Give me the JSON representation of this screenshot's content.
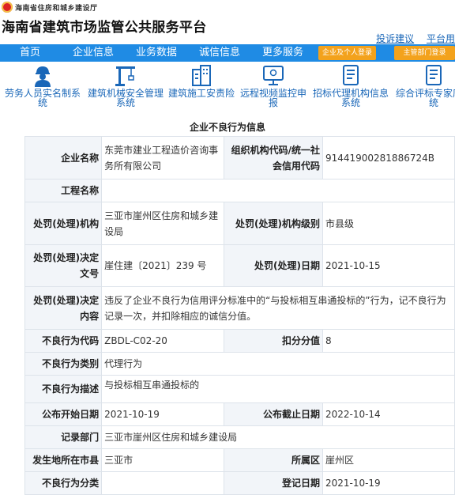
{
  "header": {
    "dept_name": "海南省住房和城乡建设厅",
    "site_title": "海南省建筑市场监管公共服务平台",
    "links": [
      "投诉建议",
      "平台用"
    ]
  },
  "nav": {
    "items": [
      "首页",
      "企业信息",
      "业务数据",
      "诚信信息",
      "更多服务"
    ],
    "buttons": [
      "企业及个人登录",
      "主管部门登录"
    ],
    "bar_color": "#1f8be4",
    "button_color": "#f3a21c"
  },
  "services": [
    {
      "label": "劳务人员实名制系统",
      "icon": "worker-icon"
    },
    {
      "label": "建筑机械安全管理系统",
      "icon": "crane-icon"
    },
    {
      "label": "建筑施工安责险",
      "icon": "buildings-icon"
    },
    {
      "label": "远程视频监控申报",
      "icon": "monitor-icon"
    },
    {
      "label": "招标代理机构信息系统",
      "icon": "document-icon"
    },
    {
      "label": "综合评标专家库系统",
      "icon": "document-icon"
    }
  ],
  "record": {
    "title": "企业不良行为信息",
    "rows": [
      {
        "k1": "企业名称",
        "v1": "东莞市建业工程造价咨询事务所有限公司",
        "k2": "组织机构代码/统一社会信用代码",
        "v2": "91441900281886724B"
      },
      {
        "k1": "工程名称",
        "v1": ""
      },
      {
        "k1": "处罚(处理)机构",
        "v1": "三亚市崖州区住房和城乡建设局",
        "k2": "处罚(处理)机构级别",
        "v2": "市县级"
      },
      {
        "k1": "处罚(处理)决定文号",
        "v1": "崖住建〔2021〕239 号",
        "k2": "处罚(处理)日期",
        "v2": "2021-10-15"
      },
      {
        "k1": "处罚(处理)决定内容",
        "v1": "违反了企业不良行为信用评分标准中的“与投标相互串通投标的”行为，记不良行为记录一次，并扣除相应的诚信分值。"
      },
      {
        "k1": "不良行为代码",
        "v1": "ZBDL-C02-20",
        "k2": "扣分分值",
        "v2": "8"
      },
      {
        "k1": "不良行为类别",
        "v1": "代理行为"
      },
      {
        "k1": "不良行为描述",
        "v1": "与投标相互串通投标的"
      },
      {
        "k1": "公布开始日期",
        "v1": "2021-10-19",
        "k2": "公布截止日期",
        "v2": "2022-10-14"
      },
      {
        "k1": "记录部门",
        "v1": "三亚市崖州区住房和城乡建设局"
      },
      {
        "k1": "发生地所在市县",
        "v1": "三亚市",
        "k2": "所属区",
        "v2": "崖州区"
      },
      {
        "k1": "不良行为分类",
        "v1": "",
        "k2": "登记日期",
        "v2": "2021-10-19"
      }
    ]
  }
}
